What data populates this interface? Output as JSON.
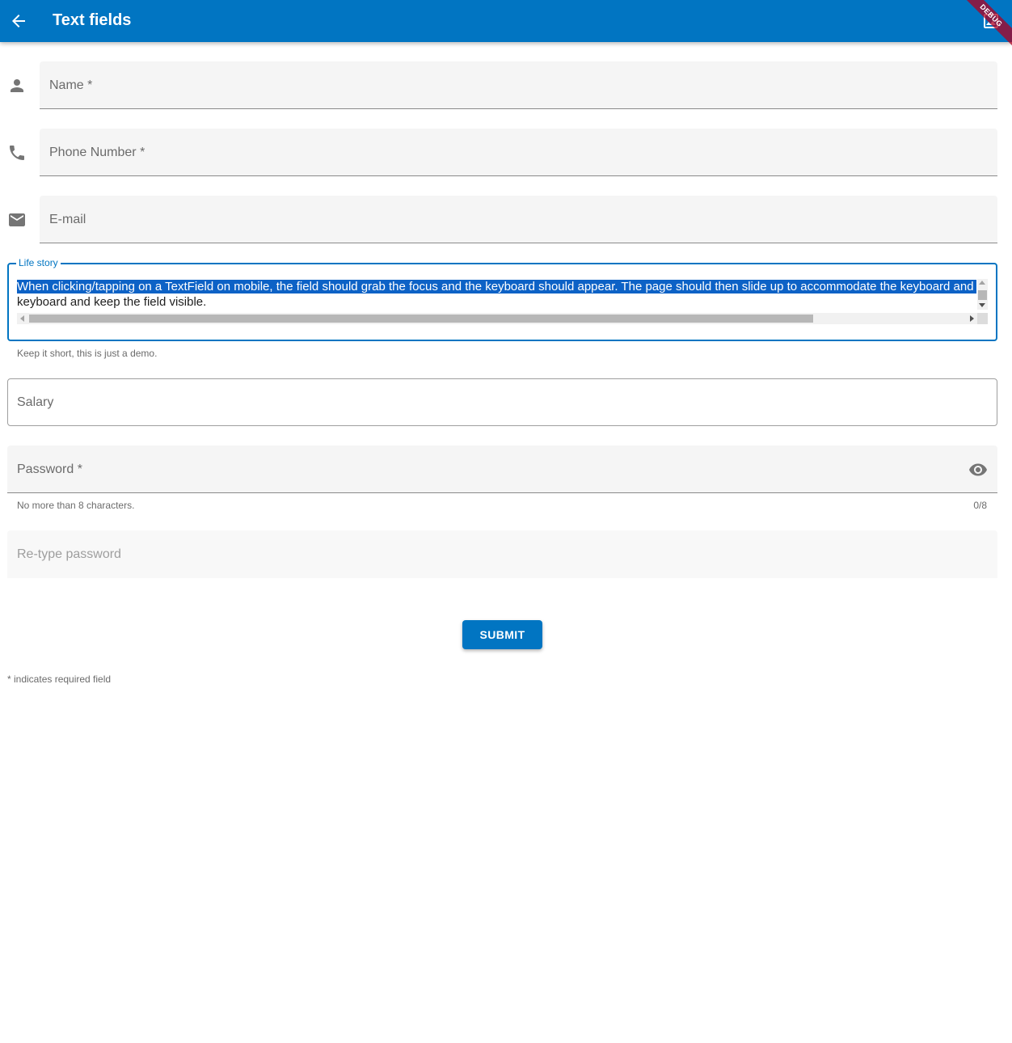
{
  "app_bar": {
    "title": "Text fields",
    "back_icon": "arrow-back-icon",
    "action_icon": "image-icon",
    "debug_banner": "DEBUG",
    "color": "#0175c2"
  },
  "form": {
    "name": {
      "label": "Name *",
      "icon": "person-icon",
      "value": ""
    },
    "phone": {
      "label": "Phone Number *",
      "icon": "phone-icon",
      "value": ""
    },
    "email": {
      "label": "E-mail",
      "icon": "email-icon",
      "value": ""
    },
    "life_story": {
      "label": "Life story",
      "line1": "When clicking/tapping on a TextField on mobile, the field should grab the focus and the keyboard should appear. The page should then slide up to accommodate the keyboard and keep the field visible.",
      "line2": "keyboard and keep the field visible.",
      "helper": "Keep it short, this is just a demo.",
      "focused": true,
      "selected": true
    },
    "salary": {
      "label": "Salary",
      "value": ""
    },
    "password": {
      "label": "Password *",
      "helper": "No more than 8 characters.",
      "counter": "0/8",
      "toggle_icon": "visibility-icon",
      "value": ""
    },
    "retype_password": {
      "label": "Re-type password",
      "enabled": false
    }
  },
  "submit": {
    "label": "SUBMIT"
  },
  "footnote": "* indicates required field",
  "colors": {
    "primary": "#0175c2",
    "selection": "#0d62c6",
    "fill": "#f5f5f5",
    "debug": "#b00020"
  }
}
